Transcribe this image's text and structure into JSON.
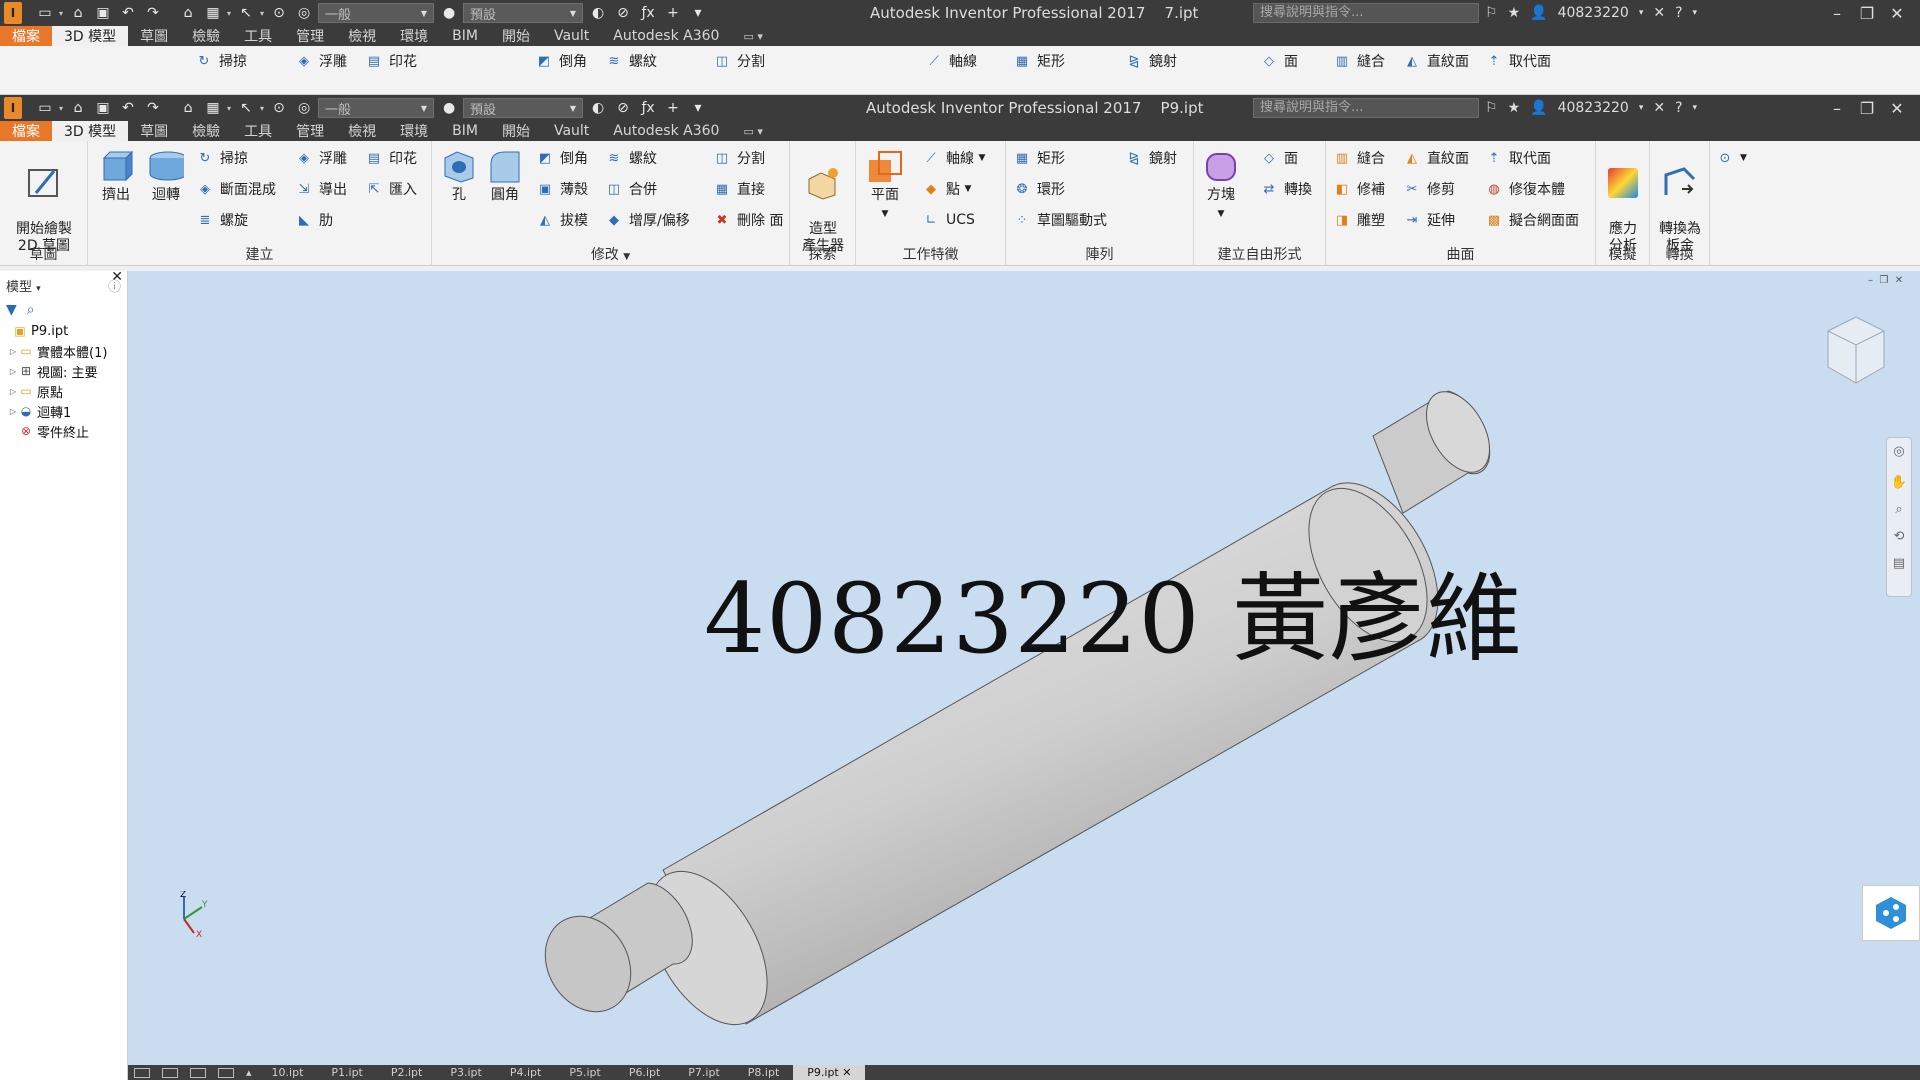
{
  "back_window": {
    "title": "Autodesk Inventor Professional 2017    7.ipt",
    "style_combo": "一般",
    "material_combo": "預設",
    "search_placeholder": "搜尋說明與指令...",
    "user": "40823220",
    "tabs": [
      "檔案",
      "3D 模型",
      "草圖",
      "檢驗",
      "工具",
      "管理",
      "檢視",
      "環境",
      "BIM",
      "開始",
      "Vault",
      "Autodesk A360"
    ]
  },
  "front_window": {
    "title": "Autodesk Inventor Professional 2017    P9.ipt",
    "style_combo": "一般",
    "material_combo": "預設",
    "search_placeholder": "搜尋說明與指令...",
    "user": "40823220",
    "tabs": [
      "檔案",
      "3D 模型",
      "草圖",
      "檢驗",
      "工具",
      "管理",
      "檢視",
      "環境",
      "BIM",
      "開始",
      "Vault",
      "Autodesk A360"
    ]
  },
  "ribbon": {
    "sketch": {
      "title": "草圖",
      "start_sketch": "開始繪製\n2D 草圖"
    },
    "create": {
      "title": "建立",
      "extrude": "擠出",
      "revolve": "迴轉",
      "sweep": "掃掠",
      "loft": "斷面混成",
      "coil": "螺旋",
      "emboss": "浮雕",
      "derive": "導出",
      "rib": "肋",
      "decal": "印花",
      "import": "匯入"
    },
    "modify": {
      "title": "修改",
      "hole": "孔",
      "fillet": "圓角",
      "chamfer": "倒角",
      "shell": "薄殼",
      "draft": "拔模",
      "thread": "螺紋",
      "combine": "合併",
      "thicken": "增厚/偏移",
      "split": "分割",
      "direct": "直接",
      "delete_face": "刪除 面"
    },
    "explore": {
      "title": "探索",
      "shape_generator": "造型\n產生器"
    },
    "work_features": {
      "title": "工作特徵",
      "plane": "平面",
      "axis": "軸線",
      "point": "點",
      "ucs": "UCS"
    },
    "pattern": {
      "title": "陣列",
      "rectangular": "矩形",
      "circular": "環形",
      "sketch_driven": "草圖驅動式",
      "mirror": "鏡射"
    },
    "freeform": {
      "title": "建立自由形式",
      "box": "方塊",
      "face": "面",
      "convert": "轉換"
    },
    "surface": {
      "title": "曲面",
      "stitch": "縫合",
      "patch": "修補",
      "sculpt": "雕塑",
      "ruled": "直紋面",
      "trim": "修剪",
      "extend": "延伸",
      "replace_face": "取代面",
      "repair_bodies": "修復本體",
      "fit_mesh": "擬合網面面"
    },
    "simulation": {
      "title": "模擬",
      "stress": "應力\n分析"
    },
    "convert": {
      "title": "轉換",
      "sheet_metal": "轉換為\n板金"
    }
  },
  "browser": {
    "title": "模型",
    "items": [
      {
        "label": "P9.ipt",
        "icon": "part-icon"
      },
      {
        "label": "實體本體(1)",
        "icon": "folder-icon"
      },
      {
        "label": "視圖: 主要",
        "icon": "view-icon"
      },
      {
        "label": "原點",
        "icon": "folder-icon"
      },
      {
        "label": "迴轉1",
        "icon": "revolve-feature-icon"
      },
      {
        "label": "零件終止",
        "icon": "end-of-part-icon"
      }
    ]
  },
  "viewport": {
    "label": "40823220 黃彥維",
    "background": "#c9dcf0"
  },
  "doc_tabs": [
    "10.ipt",
    "P1.ipt",
    "P2.ipt",
    "P3.ipt",
    "P4.ipt",
    "P5.ipt",
    "P6.ipt",
    "P7.ipt",
    "P8.ipt",
    "P9.ipt"
  ]
}
